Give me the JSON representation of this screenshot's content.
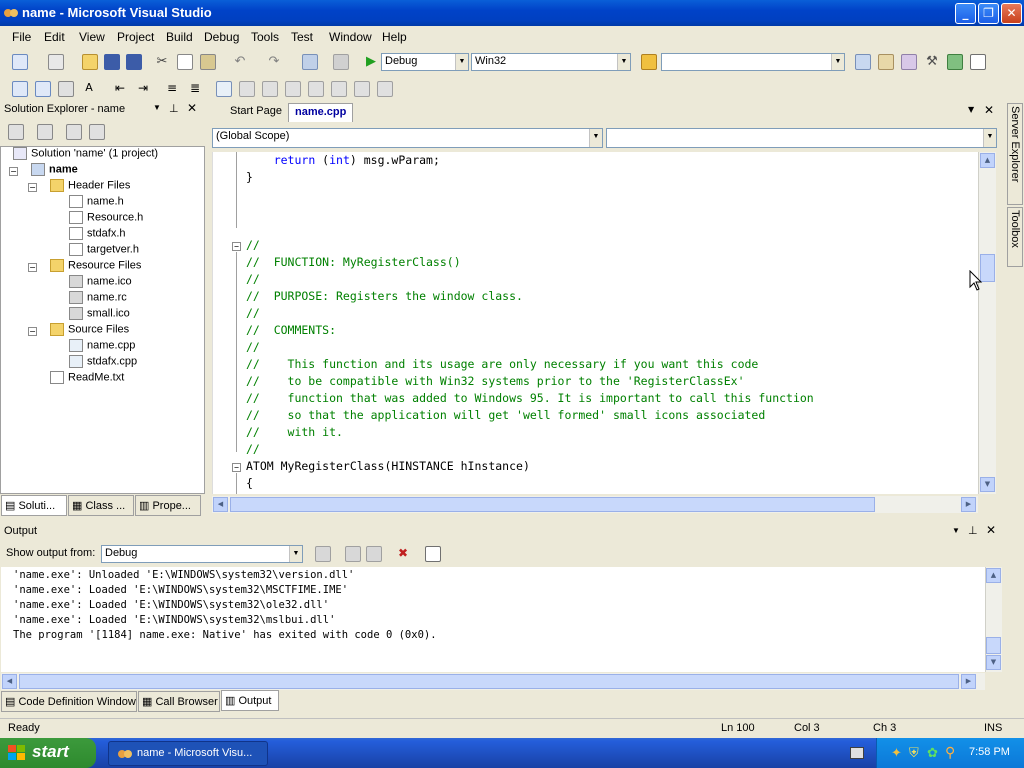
{
  "window": {
    "title": "name - Microsoft Visual Studio"
  },
  "menu": [
    "File",
    "Edit",
    "View",
    "Project",
    "Build",
    "Debug",
    "Tools",
    "Test",
    "Window",
    "Help"
  ],
  "toolbar": {
    "config": "Debug",
    "platform": "Win32",
    "find": ""
  },
  "solution_explorer": {
    "header": "Solution Explorer - name",
    "tree": [
      {
        "label": "Solution 'name' (1 project)",
        "level": 0,
        "kind": "solution"
      },
      {
        "label": "name",
        "level": 1,
        "kind": "project",
        "expand": "−"
      },
      {
        "label": "Header Files",
        "level": 2,
        "kind": "folder",
        "expand": "−"
      },
      {
        "label": "name.h",
        "level": 3,
        "kind": "file"
      },
      {
        "label": "Resource.h",
        "level": 3,
        "kind": "file"
      },
      {
        "label": "stdafx.h",
        "level": 3,
        "kind": "file"
      },
      {
        "label": "targetver.h",
        "level": 3,
        "kind": "file"
      },
      {
        "label": "Resource Files",
        "level": 2,
        "kind": "folder",
        "expand": "−"
      },
      {
        "label": "name.ico",
        "level": 3,
        "kind": "file"
      },
      {
        "label": "name.rc",
        "level": 3,
        "kind": "file"
      },
      {
        "label": "small.ico",
        "level": 3,
        "kind": "file"
      },
      {
        "label": "Source Files",
        "level": 2,
        "kind": "folder",
        "expand": "−"
      },
      {
        "label": "name.cpp",
        "level": 3,
        "kind": "file"
      },
      {
        "label": "stdafx.cpp",
        "level": 3,
        "kind": "file"
      },
      {
        "label": "ReadMe.txt",
        "level": 2,
        "kind": "file"
      }
    ],
    "tabs": [
      "Soluti...",
      "Class ...",
      "Prope..."
    ]
  },
  "editor": {
    "tabs": [
      "Start Page",
      "name.cpp"
    ],
    "scope": "(Global Scope)",
    "member": "",
    "lines": [
      {
        "t": "    return (int) msg.wParam;",
        "c": "code"
      },
      {
        "t": "}",
        "c": "code"
      },
      {
        "t": "",
        "c": "code"
      },
      {
        "t": "",
        "c": "code"
      },
      {
        "t": "",
        "c": "code"
      },
      {
        "t": "//",
        "c": "cm"
      },
      {
        "t": "//  FUNCTION: MyRegisterClass()",
        "c": "cm"
      },
      {
        "t": "//",
        "c": "cm"
      },
      {
        "t": "//  PURPOSE: Registers the window class.",
        "c": "cm"
      },
      {
        "t": "//",
        "c": "cm"
      },
      {
        "t": "//  COMMENTS:",
        "c": "cm"
      },
      {
        "t": "//",
        "c": "cm"
      },
      {
        "t": "//    This function and its usage are only necessary if you want this code",
        "c": "cm"
      },
      {
        "t": "//    to be compatible with Win32 systems prior to the 'RegisterClassEx'",
        "c": "cm"
      },
      {
        "t": "//    function that was added to Windows 95. It is important to call this function",
        "c": "cm"
      },
      {
        "t": "//    so that the application will get 'well formed' small icons associated",
        "c": "cm"
      },
      {
        "t": "//    with it.",
        "c": "cm"
      },
      {
        "t": "//",
        "c": "cm"
      },
      {
        "t": "ATOM MyRegisterClass(HINSTANCE hInstance)",
        "c": "code"
      },
      {
        "t": "{",
        "c": "code"
      }
    ]
  },
  "output": {
    "header": "Output",
    "show_label": "Show output from:",
    "source": "Debug",
    "lines": [
      "'name.exe': Unloaded 'E:\\WINDOWS\\system32\\version.dll'",
      "'name.exe': Loaded 'E:\\WINDOWS\\system32\\MSCTFIME.IME'",
      "'name.exe': Loaded 'E:\\WINDOWS\\system32\\ole32.dll'",
      "'name.exe': Loaded 'E:\\WINDOWS\\system32\\mslbui.dll'",
      "The program '[1184] name.exe: Native' has exited with code 0 (0x0)."
    ],
    "tabs": [
      "Code Definition Window",
      "Call Browser",
      "Output"
    ]
  },
  "side_tabs": [
    "Server Explorer",
    "Toolbox"
  ],
  "status": {
    "text": "Ready",
    "ln": "Ln 100",
    "col": "Col 3",
    "ch": "Ch 3",
    "mode": "INS"
  },
  "taskbar": {
    "start": "start",
    "item": "name - Microsoft Visu...",
    "clock": "7:58 PM"
  }
}
